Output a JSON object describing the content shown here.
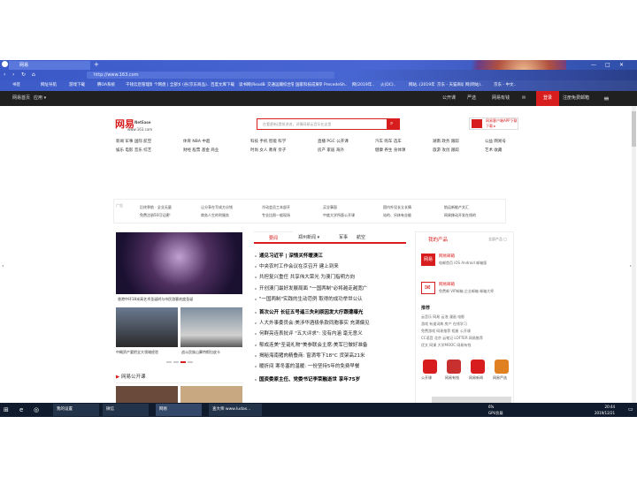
{
  "browser": {
    "tab_title": "网易",
    "url": "http://www.163.com",
    "bookmarks": [
      "书签",
      "网址导航",
      "游戏下载",
      "腾OA系统",
      "千钱云后管理新",
      "个网盘 | 全部文件",
      "(谷(京东商品)..",
      "百度文库下载",
      "读书网(ReadBoo..",
      "交通运输综合管理..",
      "国家科技成果转化..",
      "PrecedeSh..",
      "网(2019年..",
      "火(DC)..",
      "网站..(2019年12..",
      "京东 - 天猫商城..",
      "网(网站)..",
      "京东 - 中文.."
    ],
    "ad_text": "超级魔神·圣域来袭"
  },
  "site_nav": {
    "left": [
      "网易首页",
      "应用 ▾"
    ],
    "right": [
      "公开课",
      "严选",
      "网易有钱",
      "邮箱",
      "注册免费邮箱"
    ],
    "login": "登录"
  },
  "header": {
    "logo_cn": "网易",
    "logo_en": "NetEase",
    "logo_domain": "www.163.com",
    "search_placeholder": "在看更新|提前进进，详情网易云音乐在这里",
    "app_ad": "网易客户端APP下载",
    "app_ad_sub": "下载 ▸"
  },
  "categories": [
    {
      "row1": "新闻 军事 国际 航空",
      "row2": "娱乐 电影 音乐 综艺"
    },
    {
      "row1": "体育 NBA 中超",
      "row2": "财经 股票 基金 商业"
    },
    {
      "row1": "科技 手机 智能 科学",
      "row2": "时尚 女人 教育 亲子"
    },
    {
      "row1": "直播 PGC 公开课",
      "row2": "房产 家居 海外"
    },
    {
      "row1": "汽车 购车 选车",
      "row2": "健康 养生 身体课"
    },
    {
      "row1": "湖南 政务 跟踪",
      "row2": "旅游 攻创 跟踪"
    },
    {
      "row1": "公益 网易号",
      "row2": "艺术 收藏"
    }
  ],
  "ad_links": [
    "后终季航 · 全业无量",
    "让分享在写成方分钱",
    "冷动会员工本部开",
    "买全事面",
    "国内外设长立长情",
    "航运新能产文汇",
    "免费注册50可记建!",
    "商务人生的利服务",
    "专业比照一般现场",
    "中度大学所版公开课",
    "站的、另体有业能",
    "网易移动开发在线的"
  ],
  "photos": {
    "main_caption": "香港中环18米高艺术圣诞树与市民游客欢度圣诞",
    "left_caption": "中概资产要把全大领域经验",
    "right_caption": "战斗民族山寨特斯拉皮卡"
  },
  "section_title": "网易公开课",
  "news_tabs": [
    "要闻",
    "郑州新闻 ▾",
    "军事",
    "航空"
  ],
  "news": [
    {
      "text": "通见习近平 | 深情关怀暖澳江",
      "bold": true
    },
    {
      "text": "中央农村工作会议在京召开 建上到来",
      "bold": false
    },
    {
      "text": "共担复兴重任 共享伟大荣光 为澳门指明方向",
      "bold": false
    },
    {
      "text": "开创澳门最好发展局面 \"一国两制\"必将越走越宽广",
      "bold": false
    },
    {
      "text": "\"一国两制\"实践的生动范例 取得的成功举世公认",
      "bold": false
    },
    {
      "text": "首次公开 长征五号遥三失利原因发大疗跟遭曝光",
      "bold": true
    },
    {
      "text": "人大外事委员会:美涉华酒极条款同胞事实 充满偏见",
      "bold": false
    },
    {
      "text": "何群亮连表批评 \"五大评求\": 没有内涵 毫无意义",
      "bold": false
    },
    {
      "text": "郁成连美\"圣诞礼物\"美参联会主席:美军已做好准备",
      "bold": false
    },
    {
      "text": "揭秘海南猪肉精叠商: 窗滴零下18°C 货架高21米",
      "bold": false
    },
    {
      "text": "暖折间 寒冬塞的温暖: 一份坚持5年的免费早餐",
      "bold": false
    },
    {
      "text": "国资委原主任、党委书记李荣融逝世 享年75岁",
      "bold": true
    }
  ],
  "products": {
    "title": "我的产品",
    "toggle": "全部产品 □",
    "mail_name": "网易邮箱",
    "mail_links": "电邮首页 iOS Android 邮箱版",
    "mail2_name": "网易邮箱",
    "mail2_links": "免费邮 VIP邮箱 企业邮箱 邮箱大师",
    "recommend": "推荐",
    "rec_rows": [
      "云音乐 网易 云泡 漫画 电影",
      "游戏 有道词典 房产 在线学习",
      "免费游戏 网易推荐 相册 公开课",
      "CC语音 北京 云笔记 LOFTER 网易推荐",
      "优文 网课 大学MOOC 网易有钱"
    ],
    "icons": [
      "公开课",
      "网易有钱",
      "网易新闻",
      "网易严选"
    ]
  },
  "taskbar": {
    "items": [
      "我的设置",
      "微信",
      "网易",
      "查大师 www.ludas..."
    ],
    "tray": "GPU负载",
    "time": "20:44",
    "date": "2019/12/21",
    "cpu": "6%"
  }
}
